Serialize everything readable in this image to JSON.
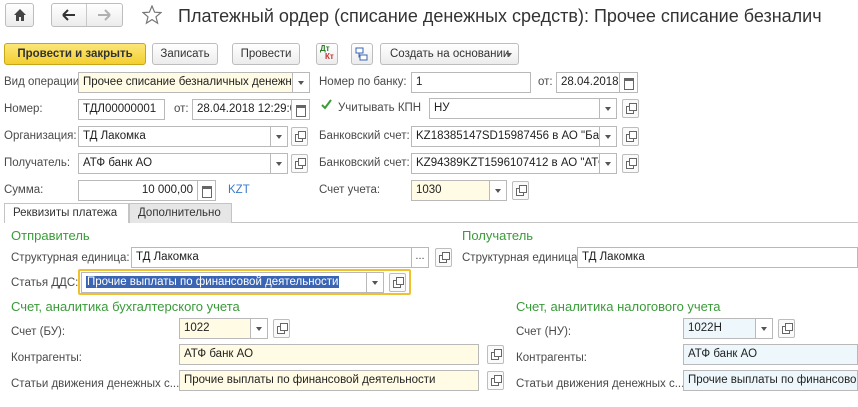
{
  "window": {
    "title": "Платежный ордер (списание денежных средств): Прочее списание безналич"
  },
  "toolbar": {
    "post_close": "Провести и закрыть",
    "write": "Записать",
    "post": "Провести",
    "dtkt_top": "Дт",
    "dtkt_bottom": "Кт",
    "create_based": "Создать на основании"
  },
  "header": {
    "op_type_label": "Вид операции:",
    "op_type_value": "Прочее списание безналичных денежны",
    "number_label": "Номер:",
    "number_value": "ТДЛ00000001",
    "from_label": "от:",
    "date_value": "28.04.2018 12:29:0",
    "org_label": "Организация:",
    "org_value": "ТД Лакомка",
    "recipient_label": "Получатель:",
    "recipient_value": "АТФ банк АО",
    "sum_label": "Сумма:",
    "sum_value": "10 000,00",
    "currency": "KZT",
    "bank_number_label": "Номер по банку:",
    "bank_number_value": "1",
    "bank_from_label": "от:",
    "bank_date_value": "28.04.2018",
    "kpn_label": "Учитывать КПН",
    "kpn_checked": true,
    "kpn_value": "НУ",
    "bank_account_label": "Банковский счет:",
    "bank_account_value": "KZ18385147SD15987456 в АО \"Бан",
    "bank_account2_label": "Банковский счет:",
    "bank_account2_value": "KZ94389KZT1596107412 в АО \"АТФ",
    "account_label": "Счет учета:",
    "account_value": "1030"
  },
  "tabs": {
    "payment": "Реквизиты платежа",
    "additional": "Дополнительно"
  },
  "payment": {
    "sender_title": "Отправитель",
    "struct_unit_label": "Структурная единица:",
    "struct_unit_value": "ТД Лакомка",
    "dds_label": "Статья ДДС:",
    "dds_value": "Прочие выплаты по финансовой деятельности",
    "recipient_title": "Получатель",
    "r_struct_unit_label": "Структурная единица:",
    "r_struct_unit_value": "ТД Лакомка",
    "bu_title": "Счет, аналитика бухгалтерского учета",
    "bu_account_label": "Счет (БУ):",
    "bu_account_value": "1022",
    "bu_counterparty_label": "Контрагенты:",
    "bu_counterparty_value": "АТФ банк АО",
    "bu_cashflow_label": "Статьи движения денежных с...",
    "bu_cashflow_value": "Прочие выплаты по финансовой деятельности",
    "nu_title": "Счет, аналитика налогового учета",
    "nu_account_label": "Счет (НУ):",
    "nu_account_value": "1022Н",
    "nu_counterparty_label": "Контрагенты:",
    "nu_counterparty_value": "АТФ банк АО",
    "nu_cashflow_label": "Статьи движения денежных с...",
    "nu_cashflow_value": "Прочие выплаты по финансовой деятельности"
  },
  "colors": {
    "accent_yellow": "#f3cf2f",
    "section_green": "#3a9b3a",
    "link_blue": "#3a7bc8",
    "focus_border": "#f0c030",
    "selection": "#3a64b4"
  }
}
